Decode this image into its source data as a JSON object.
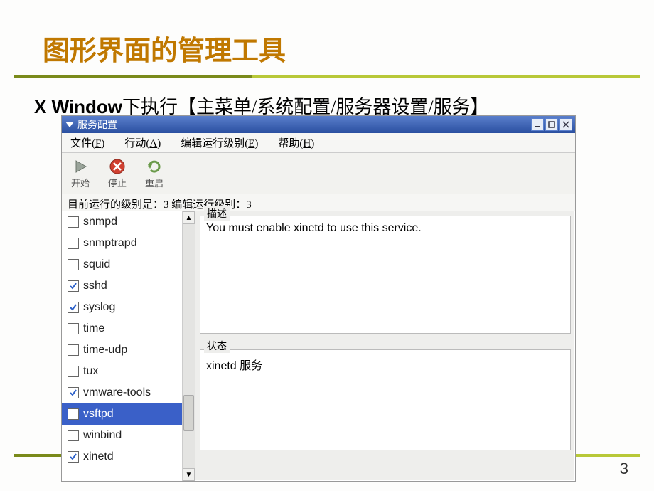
{
  "slide": {
    "title": "图形界面的管理工具",
    "instruction_prefix": "X Window",
    "instruction_rest": "下执行【主菜单/系统配置/服务器设置/服务】",
    "page_number": "3"
  },
  "window": {
    "title": "服务配置",
    "menu": {
      "file": "文件(F)",
      "action": "行动(A)",
      "edit_runlevel": "编辑运行级别(E)",
      "help": "帮助(H)"
    },
    "toolbar": {
      "start": "开始",
      "stop": "停止",
      "restart": "重启"
    },
    "status_line": "目前运行的级别是：3  编辑运行级别：3",
    "services": [
      {
        "name": "snmpd",
        "checked": false
      },
      {
        "name": "snmptrapd",
        "checked": false
      },
      {
        "name": "squid",
        "checked": false
      },
      {
        "name": "sshd",
        "checked": true
      },
      {
        "name": "syslog",
        "checked": true
      },
      {
        "name": "time",
        "checked": false
      },
      {
        "name": "time-udp",
        "checked": false
      },
      {
        "name": "tux",
        "checked": false
      },
      {
        "name": "vmware-tools",
        "checked": true
      },
      {
        "name": "vsftpd",
        "checked": false,
        "selected": true
      },
      {
        "name": "winbind",
        "checked": false
      },
      {
        "name": "xinetd",
        "checked": true
      }
    ],
    "description": {
      "label": "描述",
      "text": "You must enable xinetd to use this service."
    },
    "status": {
      "label": "状态",
      "text": "xinetd 服务"
    }
  }
}
